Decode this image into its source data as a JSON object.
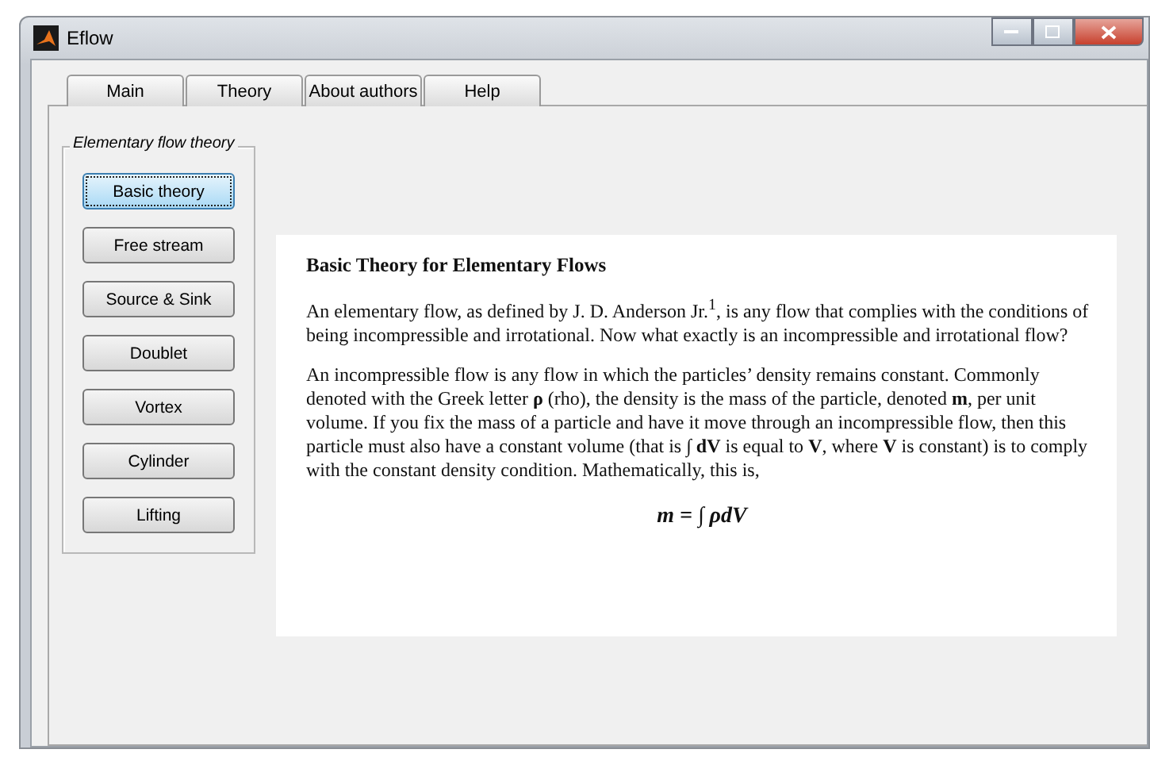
{
  "window": {
    "title": "Eflow"
  },
  "tabs": [
    {
      "label": "Main"
    },
    {
      "label": "Theory"
    },
    {
      "label": "About authors"
    },
    {
      "label": "Help"
    }
  ],
  "group": {
    "title": "Elementary flow theory",
    "buttons": [
      {
        "label": "Basic theory",
        "selected": true
      },
      {
        "label": "Free stream",
        "selected": false
      },
      {
        "label": "Source & Sink",
        "selected": false
      },
      {
        "label": "Doublet",
        "selected": false
      },
      {
        "label": "Vortex",
        "selected": false
      },
      {
        "label": "Cylinder",
        "selected": false
      },
      {
        "label": "Lifting",
        "selected": false
      }
    ]
  },
  "document": {
    "heading": "Basic Theory for Elementary Flows",
    "paragraphs": [
      "An elementary flow, as defined by J. D. Anderson Jr.$^{1}$, is any flow that complies with the conditions of being incompressible and irrotational.  Now what exactly is an incompressible and irrotational flow?",
      "An incompressible flow is any flow in which the particles’ density remains constant.  Commonly denoted with the Greek letter **ρ** (rho), the density is the mass of the particle, denoted **m**,  per unit volume.  If you fix the mass of a particle and have it move through an incompressible flow, then this particle must also have a constant volume (that is ∫ **dV** is equal to **V**, where **V** is constant) is to comply with the constant density condition.  Mathematically, this is,"
    ],
    "equation": "m = ∫ ρdV"
  }
}
